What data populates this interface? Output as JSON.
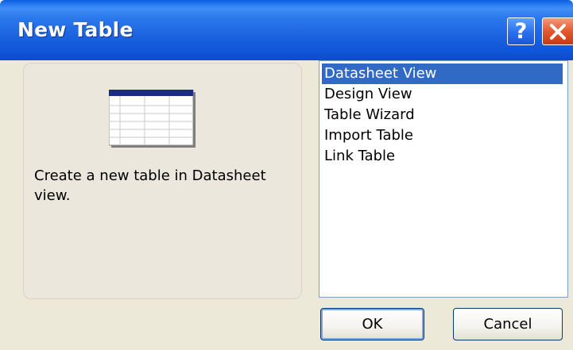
{
  "window": {
    "title": "New Table",
    "help_glyph": "?",
    "close_icon": "close-icon",
    "titlebar_color": "#0b5ad9"
  },
  "description": {
    "text": "Create a new table in Datasheet view.",
    "preview_icon": "datasheet-preview-icon"
  },
  "views": {
    "selected": "Datasheet View",
    "items": [
      {
        "label": "Datasheet View"
      },
      {
        "label": "Design View"
      },
      {
        "label": "Table Wizard"
      },
      {
        "label": "Import Table"
      },
      {
        "label": "Link Table"
      }
    ]
  },
  "buttons": {
    "ok": "OK",
    "cancel": "Cancel"
  },
  "colors": {
    "selection": "#316ac5",
    "dialog_face": "#ece9d8"
  }
}
